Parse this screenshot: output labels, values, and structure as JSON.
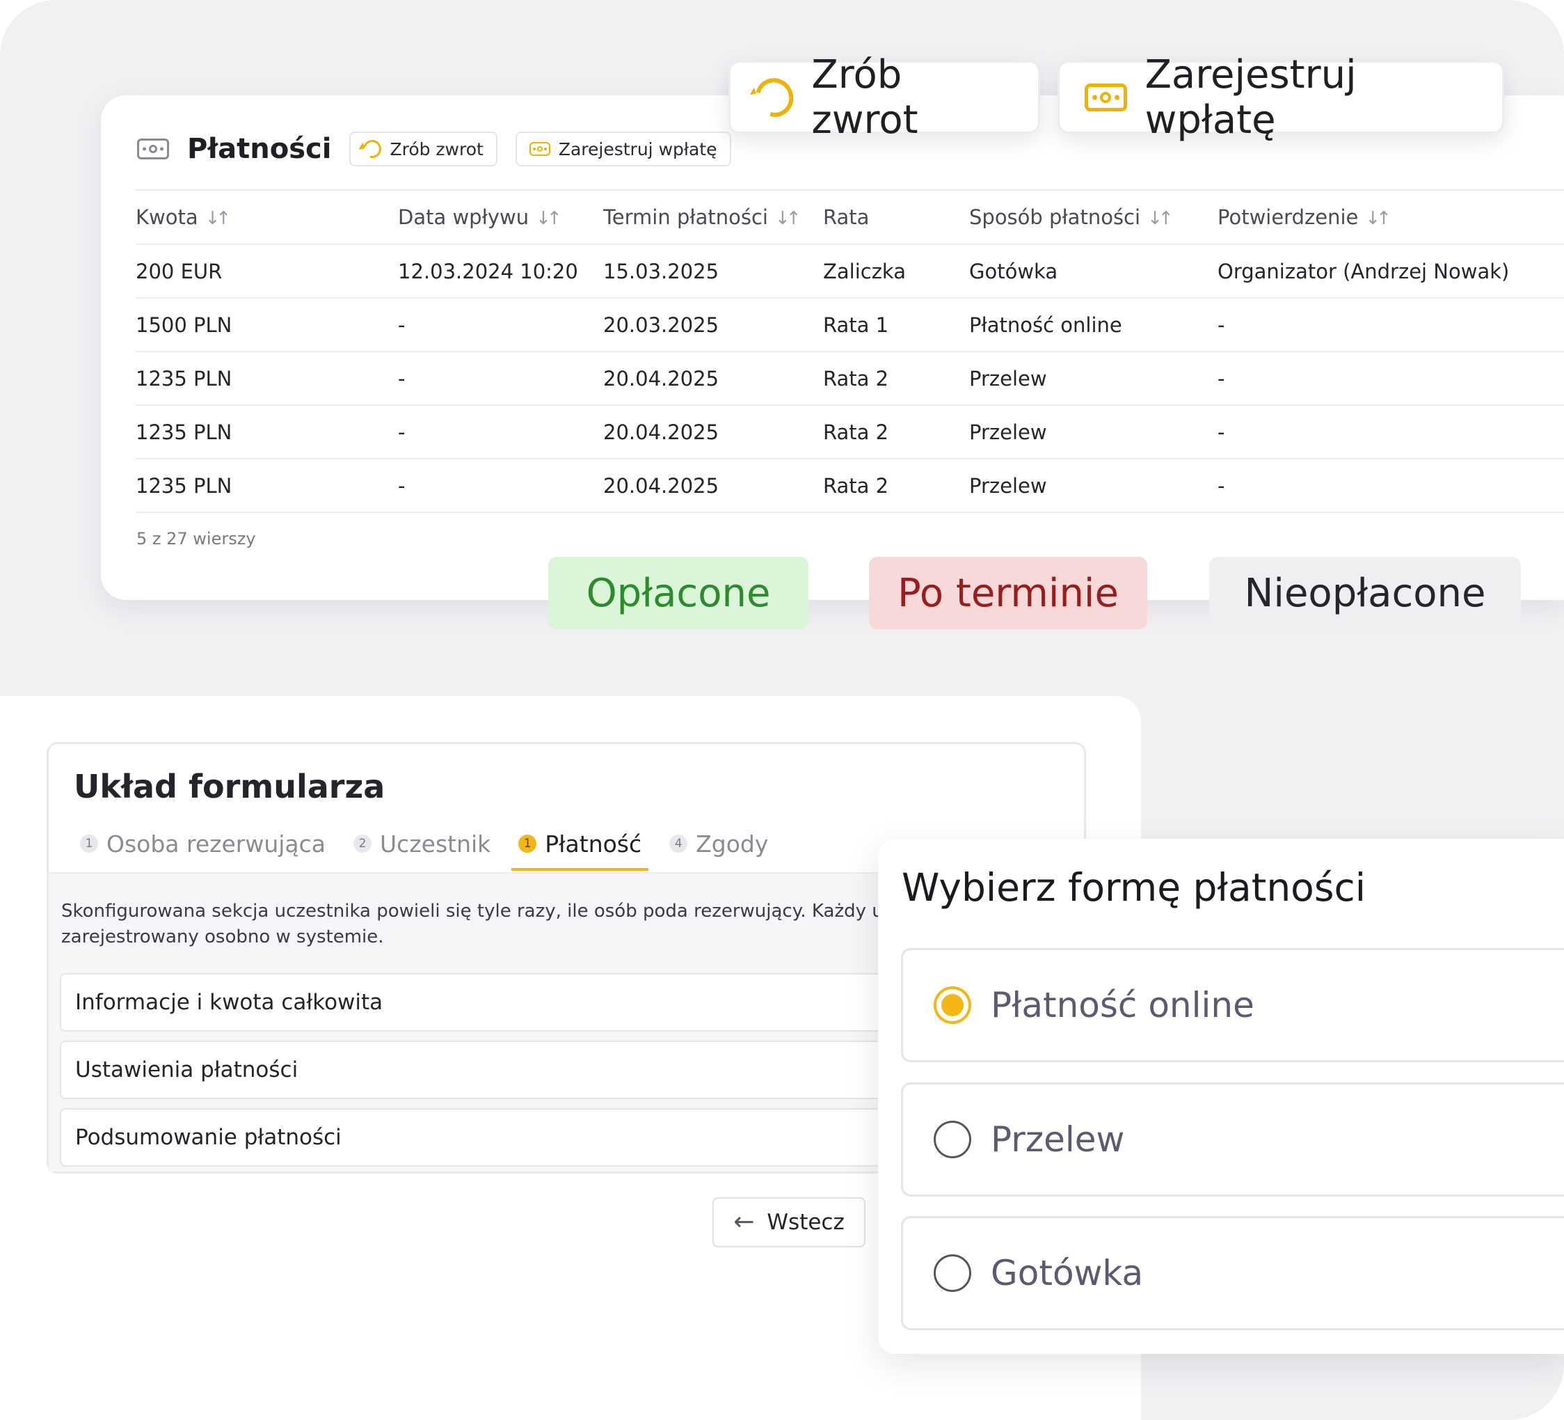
{
  "colors": {
    "accent": "#f3b615",
    "paid": "#2e8a2e",
    "late": "#9b1c1c"
  },
  "payments": {
    "title": "Płatności",
    "refund_label": "Zrób zwrot",
    "register_label": "Zarejestruj wpłatę",
    "columns": [
      "Kwota",
      "Data wpływu",
      "Termin płatności",
      "Rata",
      "Sposób płatności",
      "Potwierdzenie"
    ],
    "rows": [
      [
        "200 EUR",
        "12.03.2024 10:20",
        "15.03.2025",
        "Zaliczka",
        "Gotówka",
        "Organizator (Andrzej Nowak)"
      ],
      [
        "1500 PLN",
        "-",
        "20.03.2025",
        "Rata 1",
        "Płatność online",
        "-"
      ],
      [
        "1235 PLN",
        "-",
        "20.04.2025",
        "Rata 2",
        "Przelew",
        "-"
      ],
      [
        "1235 PLN",
        "-",
        "20.04.2025",
        "Rata 2",
        "Przelew",
        "-"
      ],
      [
        "1235 PLN",
        "-",
        "20.04.2025",
        "Rata 2",
        "Przelew",
        "-"
      ]
    ],
    "rows_count": "5 z 27 wierszy"
  },
  "floating": {
    "refund_label": "Zrób zwrot",
    "register_label": "Zarejestruj wpłatę"
  },
  "statuses": {
    "paid": "Opłacone",
    "late": "Po terminie",
    "unpaid": "Nieopłacone"
  },
  "form": {
    "title": "Układ formularza",
    "steps": [
      {
        "num": "1",
        "label": "Osoba rezerwująca"
      },
      {
        "num": "2",
        "label": "Uczestnik"
      },
      {
        "num": "1",
        "label": "Płatność"
      },
      {
        "num": "4",
        "label": "Zgody"
      }
    ],
    "description": "Skonfigurowana sekcja uczestnika powieli się tyle razy, ile osób poda rezerwujący. Każdy uczestnik zostanie zarejestrowany osobno w systemie.",
    "sections": [
      "Informacje i kwota całkowita",
      "Ustawienia płatności",
      "Podsumowanie płatności"
    ],
    "back_label": "Wstecz"
  },
  "choice": {
    "title": "Wybierz formę płatności",
    "options": [
      "Płatność online",
      "Przelew",
      "Gotówka"
    ],
    "selected": "Płatność online"
  }
}
